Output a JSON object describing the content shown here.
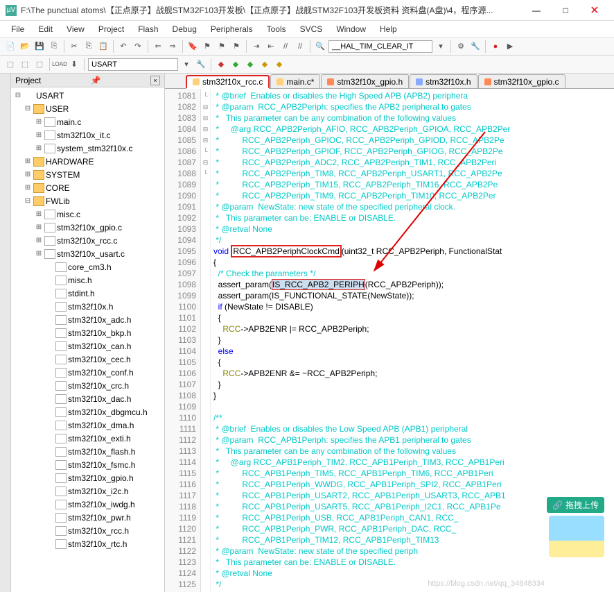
{
  "window": {
    "app_badge": "µV",
    "title": "F:\\The punctual atoms\\【正点原子】战舰STM32F103开发板\\【正点原子】战舰STM32F103开发板资料 资料盘(A盘)\\4，程序源...",
    "min": "—",
    "max": "□",
    "close": "✕"
  },
  "menu": [
    "File",
    "Edit",
    "View",
    "Project",
    "Flash",
    "Debug",
    "Peripherals",
    "Tools",
    "SVCS",
    "Window",
    "Help"
  ],
  "toolbar2": {
    "combo": "USART",
    "search": "__HAL_TIM_CLEAR_IT"
  },
  "project": {
    "title": "Project",
    "root": "USART",
    "groups": [
      {
        "name": "USER",
        "open": true,
        "files": [
          "main.c",
          "stm32f10x_it.c",
          "system_stm32f10x.c"
        ]
      },
      {
        "name": "HARDWARE",
        "open": false
      },
      {
        "name": "SYSTEM",
        "open": false
      },
      {
        "name": "CORE",
        "open": false
      },
      {
        "name": "FWLib",
        "open": true,
        "files": [
          "misc.c",
          "stm32f10x_gpio.c",
          "stm32f10x_rcc.c",
          "stm32f10x_usart.c"
        ],
        "headers": [
          "core_cm3.h",
          "misc.h",
          "stdint.h",
          "stm32f10x.h",
          "stm32f10x_adc.h",
          "stm32f10x_bkp.h",
          "stm32f10x_can.h",
          "stm32f10x_cec.h",
          "stm32f10x_conf.h",
          "stm32f10x_crc.h",
          "stm32f10x_dac.h",
          "stm32f10x_dbgmcu.h",
          "stm32f10x_dma.h",
          "stm32f10x_exti.h",
          "stm32f10x_flash.h",
          "stm32f10x_fsmc.h",
          "stm32f10x_gpio.h",
          "stm32f10x_i2c.h",
          "stm32f10x_iwdg.h",
          "stm32f10x_pwr.h",
          "stm32f10x_rcc.h",
          "stm32f10x_rtc.h"
        ]
      }
    ]
  },
  "tabs": [
    {
      "label": "stm32f10x_rcc.c",
      "color": "#ffd27a",
      "active": true
    },
    {
      "label": "main.c*",
      "color": "#ffd27a"
    },
    {
      "label": "stm32f10x_gpio.h",
      "color": "#ff8855"
    },
    {
      "label": "stm32f10x.h",
      "color": "#88aaff"
    },
    {
      "label": "stm32f10x_gpio.c",
      "color": "#ff8855"
    }
  ],
  "code": {
    "first_line": 1081,
    "lines": [
      " * @brief  Enables or disables the High Speed APB (APB2) periphera",
      " * @param  RCC_APB2Periph: specifies the APB2 peripheral to gates ",
      " *   This parameter can be any combination of the following values",
      " *     @arg RCC_APB2Periph_AFIO, RCC_APB2Periph_GPIOA, RCC_APB2Per",
      " *          RCC_APB2Periph_GPIOC, RCC_APB2Periph_GPIOD, RCC_APB2Pe",
      " *          RCC_APB2Periph_GPIOF, RCC_APB2Periph_GPIOG, RCC_APB2Pe",
      " *          RCC_APB2Periph_ADC2, RCC_APB2Periph_TIM1, RCC_APB2Peri",
      " *          RCC_APB2Periph_TIM8, RCC_APB2Periph_USART1, RCC_APB2Pe",
      " *          RCC_APB2Periph_TIM15, RCC_APB2Periph_TIM16, RCC_APB2Pe",
      " *          RCC_APB2Periph_TIM9, RCC_APB2Periph_TIM10, RCC_APB2Per",
      " * @param  NewState: new state of the specified peripheral clock.",
      " *   This parameter can be: ENABLE or DISABLE.",
      " * @retval None",
      " */",
      "void RCC_APB2PeriphClockCmd(uint32_t RCC_APB2Periph, FunctionalStat",
      "{",
      "  /* Check the parameters */",
      "  assert_param(IS_RCC_APB2_PERIPH(RCC_APB2Periph));",
      "  assert_param(IS_FUNCTIONAL_STATE(NewState));",
      "  if (NewState != DISABLE)",
      "  {",
      "    RCC->APB2ENR |= RCC_APB2Periph;",
      "  }",
      "  else",
      "  {",
      "    RCC->APB2ENR &= ~RCC_APB2Periph;",
      "  }",
      "}",
      "",
      "/**",
      " * @brief  Enables or disables the Low Speed APB (APB1) peripheral",
      " * @param  RCC_APB1Periph: specifies the APB1 peripheral to gates ",
      " *   This parameter can be any combination of the following values",
      " *     @arg RCC_APB1Periph_TIM2, RCC_APB1Periph_TIM3, RCC_APB1Peri",
      " *          RCC_APB1Periph_TIM5, RCC_APB1Periph_TIM6, RCC_APB1Peri",
      " *          RCC_APB1Periph_WWDG, RCC_APB1Periph_SPI2, RCC_APB1Peri",
      " *          RCC_APB1Periph_USART2, RCC_APB1Periph_USART3, RCC_APB1",
      " *          RCC_APB1Periph_USART5, RCC_APB1Periph_I2C1, RCC_APB1Pe",
      " *          RCC_APB1Periph_USB, RCC_APB1Periph_CAN1, RCC_",
      " *          RCC_APB1Periph_PWR, RCC_APB1Periph_DAC, RCC_",
      " *          RCC_APB1Periph_TIM12, RCC_APB1Periph_TIM13",
      " * @param  NewState: new state of the specified periph",
      " *   This parameter can be: ENABLE or DISABLE.",
      " * @retval None",
      " */"
    ]
  },
  "badge": {
    "upload": "拖拽上传"
  },
  "watermark": "https://blog.csdn.net/qq_34848334"
}
